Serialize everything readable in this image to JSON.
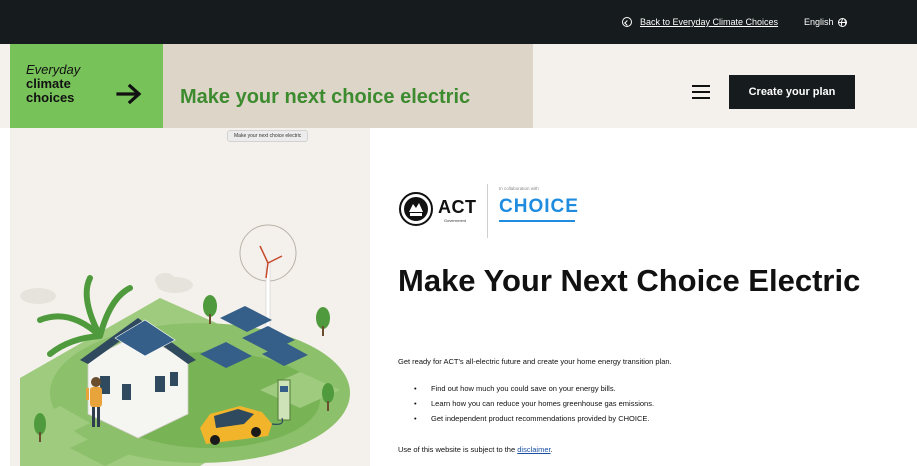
{
  "topbar": {
    "back_link": "Back to Everyday Climate Choices",
    "language": "English"
  },
  "header": {
    "logo_line1": "Everyday",
    "logo_line2": "climate",
    "logo_line3": "choices",
    "site_title": "Make your next choice electric",
    "create_button": "Create your plan"
  },
  "tooltip": "Make your next choice electric",
  "partners": {
    "act_word": "ACT",
    "act_sub": "Government",
    "collab_text": "In collaboration with",
    "choice_word": "CHOICE"
  },
  "main": {
    "heading": "Make Your Next Choice Electric",
    "intro": "Get ready for ACT's all-electric future and create your home energy transition plan.",
    "bullets": [
      "Find out how much you could save on your energy bills.",
      "Learn how you can reduce your homes greenhouse gas emissions.",
      "Get independent product recommendations provided by CHOICE."
    ],
    "disclaimer_prefix": "Use of this website is subject to the ",
    "disclaimer_link": "disclaimer",
    "disclaimer_suffix": "."
  },
  "colors": {
    "topbar": "#161b1d",
    "logo_green": "#78c25a",
    "title_green": "#3d8b2f",
    "header_beige": "#ded5c9",
    "choice_blue": "#1f8ce0"
  }
}
